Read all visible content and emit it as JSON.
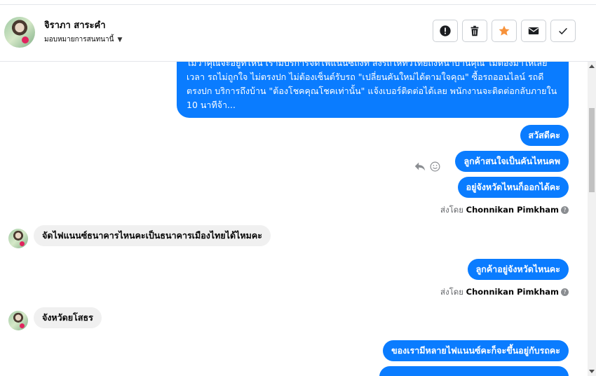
{
  "header": {
    "name": "จิราภา สาระคำ",
    "assign_label": "มอบหมายการสนทนานี้",
    "actions": [
      {
        "icon": "alert-icon",
        "color": "#1c1e21"
      },
      {
        "icon": "trash-icon",
        "color": "#1c1e21"
      },
      {
        "icon": "star-icon",
        "color": "#f7923a"
      },
      {
        "icon": "envelope-icon",
        "color": "#1c1e21"
      },
      {
        "icon": "check-icon",
        "color": "#1c1e21"
      }
    ]
  },
  "messages": {
    "long_text": "ไม่ว่าคุณจะอยู่ที่ไหน เรามีบริการจัดไฟแนนซ์ถึงที่ ส่งรถให้ทั่วไทยถึงหน้าบ้านคุณ ไม่ต้องมาให้เสียเวลา รถไม่ถูกใจ ไม่ตรงปก ไม่ต้องเซ็นต์รับรถ \"เปลี่ยนคันใหม่ได้ตามใจคุณ\" ซื้อรถออนไลน์ รถดี ตรงปก บริการถึงบ้าน \"ต้องโชคคุณโชคเท่านั้น\" แจ้งเบอร์ติดต่อได้เลย พนักงานจะติดต่อกลับภายใน 10 นาทีจ้า...",
    "out1": "สวัสดีคะ",
    "out2": "ลูกค้าสนใจเป็นคันไหนคพ",
    "out3": "อยู่จังหวัดไหนก็ออกได้คะ",
    "sent_by_prefix": "ส่งโดย",
    "sent_by_name": "Chonnikan Pimkham",
    "in1": "จัดไฟแนนซ์ธนาคารไหนคะเป็นธนาคารเมืองไทยได้ไหมคะ",
    "out4": "ลูกค้าอยู่จังหวัดไหนคะ",
    "in2": "จังหวัดยโสธร",
    "out5": "ของเรามีหลายไฟแนนซ์คะก็จะขึ้นอยู่กับรถคะ"
  },
  "colors": {
    "outgoing_bubble": "#0a7cff",
    "incoming_bubble": "#f0f0f0",
    "star": "#f7923a"
  }
}
